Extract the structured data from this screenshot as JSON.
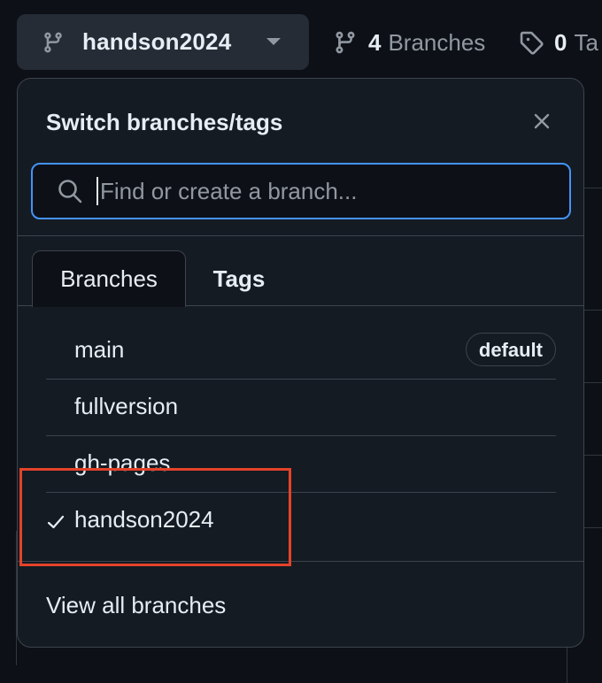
{
  "branch_selector": {
    "current": "handson2024"
  },
  "repo_meta": {
    "branches_count": "4",
    "branches_label": "Branches",
    "tags_count": "0",
    "tags_label": "Ta"
  },
  "dropdown": {
    "title": "Switch branches/tags",
    "search_placeholder": "Find or create a branch...",
    "tabs": [
      {
        "label": "Branches",
        "active": true
      },
      {
        "label": "Tags",
        "active": false
      }
    ],
    "branches": [
      {
        "name": "main",
        "badge": "default",
        "selected": false
      },
      {
        "name": "fullversion",
        "badge": "",
        "selected": false
      },
      {
        "name": "gh-pages",
        "badge": "",
        "selected": false
      },
      {
        "name": "handson2024",
        "badge": "",
        "selected": true
      }
    ],
    "footer_link": "View all branches"
  },
  "colors": {
    "accent": "#4493f8",
    "highlight": "#e5432a",
    "background": "#0d1117",
    "panel": "#151b23"
  },
  "icons": {
    "branch": "git-branch-icon",
    "tag": "tag-icon",
    "search": "search-icon",
    "close": "close-icon",
    "check": "check-icon"
  }
}
